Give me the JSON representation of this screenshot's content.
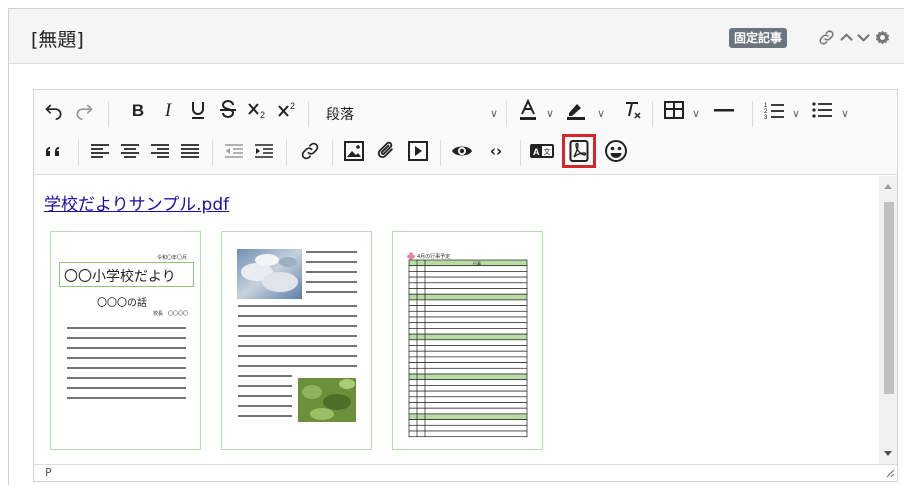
{
  "panel": {
    "title": "[無題]",
    "badge": "固定記事",
    "actions": [
      "link-icon",
      "chevron-up-icon",
      "chevron-down-icon",
      "gear-icon"
    ]
  },
  "toolbar": {
    "row1": [
      "undo",
      "redo",
      "bold",
      "italic",
      "underline",
      "strikethrough",
      "subscript",
      "superscript",
      "block-format",
      "font-color",
      "highlight-color",
      "clear-format",
      "table",
      "horizontal-rule",
      "numbered-list",
      "bulleted-list"
    ],
    "row2": [
      "blockquote",
      "align-left",
      "align-center",
      "align-right",
      "align-justify",
      "outdent",
      "indent",
      "link",
      "image",
      "attachment",
      "video",
      "preview",
      "source-code",
      "translate",
      "pdf",
      "emoji"
    ],
    "block_format_label": "段落",
    "highlighted": "pdf"
  },
  "content": {
    "link_text": "学校だよりサンプル.pdf",
    "page1": {
      "date": "令和〇年〇月",
      "title": "〇〇小学校だより",
      "subtitle": "〇〇〇の話",
      "author": "校長　〇〇〇〇"
    },
    "page3": {
      "title": "4月の行事予定",
      "column": "行事"
    }
  },
  "statusbar": {
    "path": "P"
  },
  "colors": {
    "highlight": "#d7262b",
    "link": "#1a0dab",
    "thumb_border": "#b8ddb0",
    "badge": "#6c757d"
  }
}
